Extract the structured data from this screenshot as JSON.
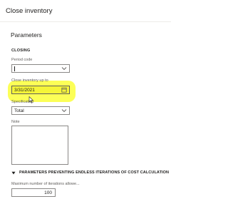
{
  "header": {
    "title": "Close inventory"
  },
  "parameters": {
    "heading": "Parameters",
    "group_heading": "CLOSING",
    "period_code": {
      "label": "Period code",
      "value": ""
    },
    "close_up_to": {
      "label": "Close inventory up to",
      "value": "3/31/2021"
    },
    "specification": {
      "label": "Specification",
      "value": "Total"
    },
    "note": {
      "label": "Note",
      "value": ""
    }
  },
  "iterations_section": {
    "heading": "PARAMETERS PREVENTING ENDLESS ITERATIONS OF COST CALCULATION",
    "max_iterations": {
      "label": "Maximum number of iterations allowe...",
      "value": "100"
    }
  },
  "colors": {
    "highlight": "#fbff3a",
    "border": "#8a8886"
  },
  "icons": [
    "chevron-down-icon",
    "calendar-icon",
    "mouse-pointer-icon",
    "collapse-triangle-icon"
  ]
}
